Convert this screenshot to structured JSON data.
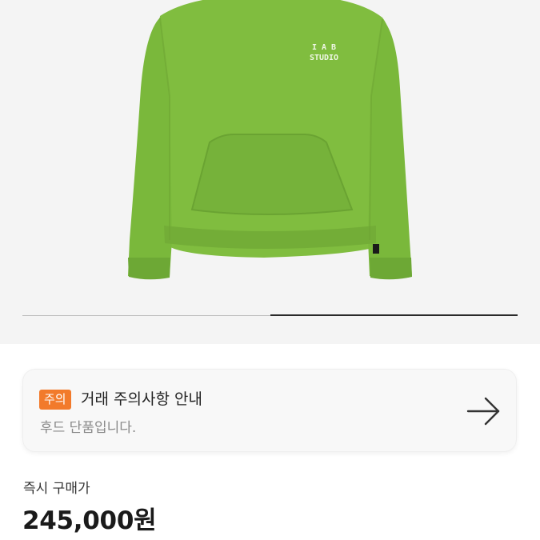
{
  "product": {
    "image_alt": "Green hoodie with IAB STUDIO print",
    "logo_line1": "I  A  B",
    "logo_line2": "STUDIO",
    "image_progress": 0.5,
    "colors": {
      "hoodie": "#80bd3f",
      "hoodie_dark": "#6da835",
      "background": "#f4f4f4"
    }
  },
  "notice": {
    "badge": "주의",
    "title": "거래 주의사항 안내",
    "subtitle": "후드 단품입니다.",
    "arrow_icon": "arrow-right-icon",
    "badge_color": "#f27a2b"
  },
  "price": {
    "label": "즉시 구매가",
    "value": "245,000원"
  }
}
